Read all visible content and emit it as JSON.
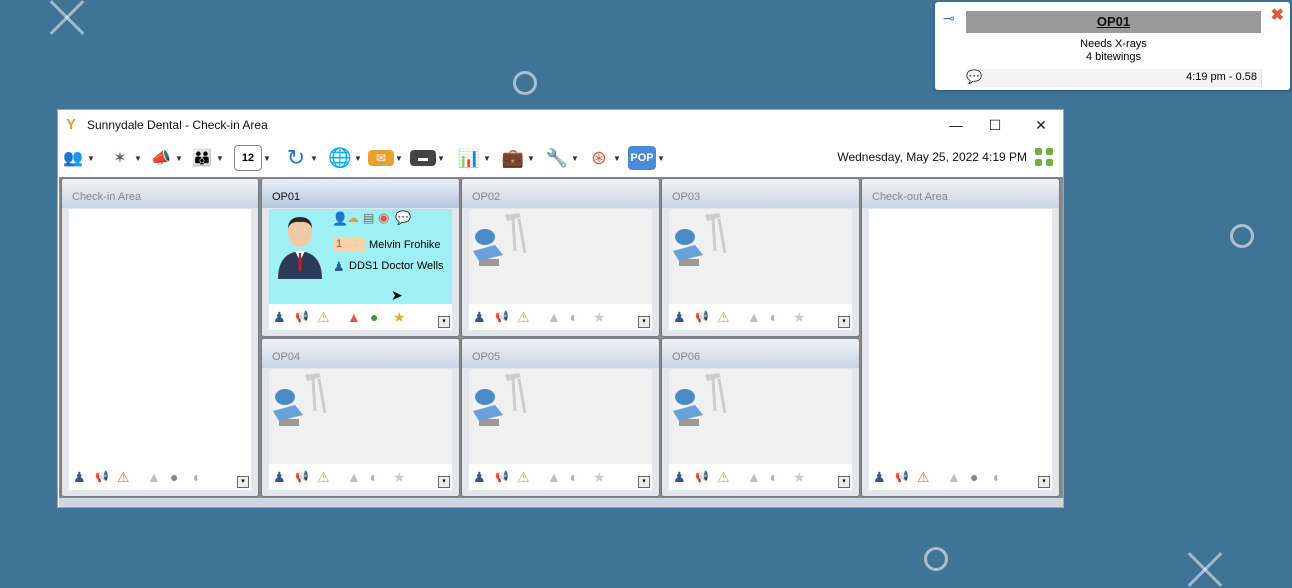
{
  "popup": {
    "operatory": "OP01",
    "note_line1": "Needs  X-rays",
    "note_line2": "4 bitewings",
    "time": "4:19 pm - 0.58"
  },
  "window": {
    "title": "Sunnydale Dental - Check-in Area",
    "date": "Wednesday, May 25, 2022 4:19 PM",
    "pop_label": "POP"
  },
  "panels": {
    "checkin": {
      "label": "Check-in Area"
    },
    "op01": {
      "label": "OP01",
      "badge": "1",
      "patient": "Melvin Frohike",
      "provider": "DDS1 Doctor Wells"
    },
    "op02": {
      "label": "OP02"
    },
    "op03": {
      "label": "OP03"
    },
    "op04": {
      "label": "OP04"
    },
    "op05": {
      "label": "OP05"
    },
    "op06": {
      "label": "OP06"
    },
    "checkout": {
      "label": "Check-out Area"
    }
  },
  "icons": {
    "toolbar": [
      "patients-icon",
      "tower-icon",
      "megaphone-icon",
      "family-icon",
      "calendar-icon",
      "refresh-icon",
      "globe-icon",
      "mail-icon",
      "folder-icon",
      "chart-icon",
      "briefcase-icon",
      "wrench-icon",
      "lifebuoy-icon",
      "pop-icon"
    ],
    "colors": {
      "accent": "#3f7496",
      "active_panel": "#9ef0f5",
      "alert": "#e05a3a"
    }
  }
}
